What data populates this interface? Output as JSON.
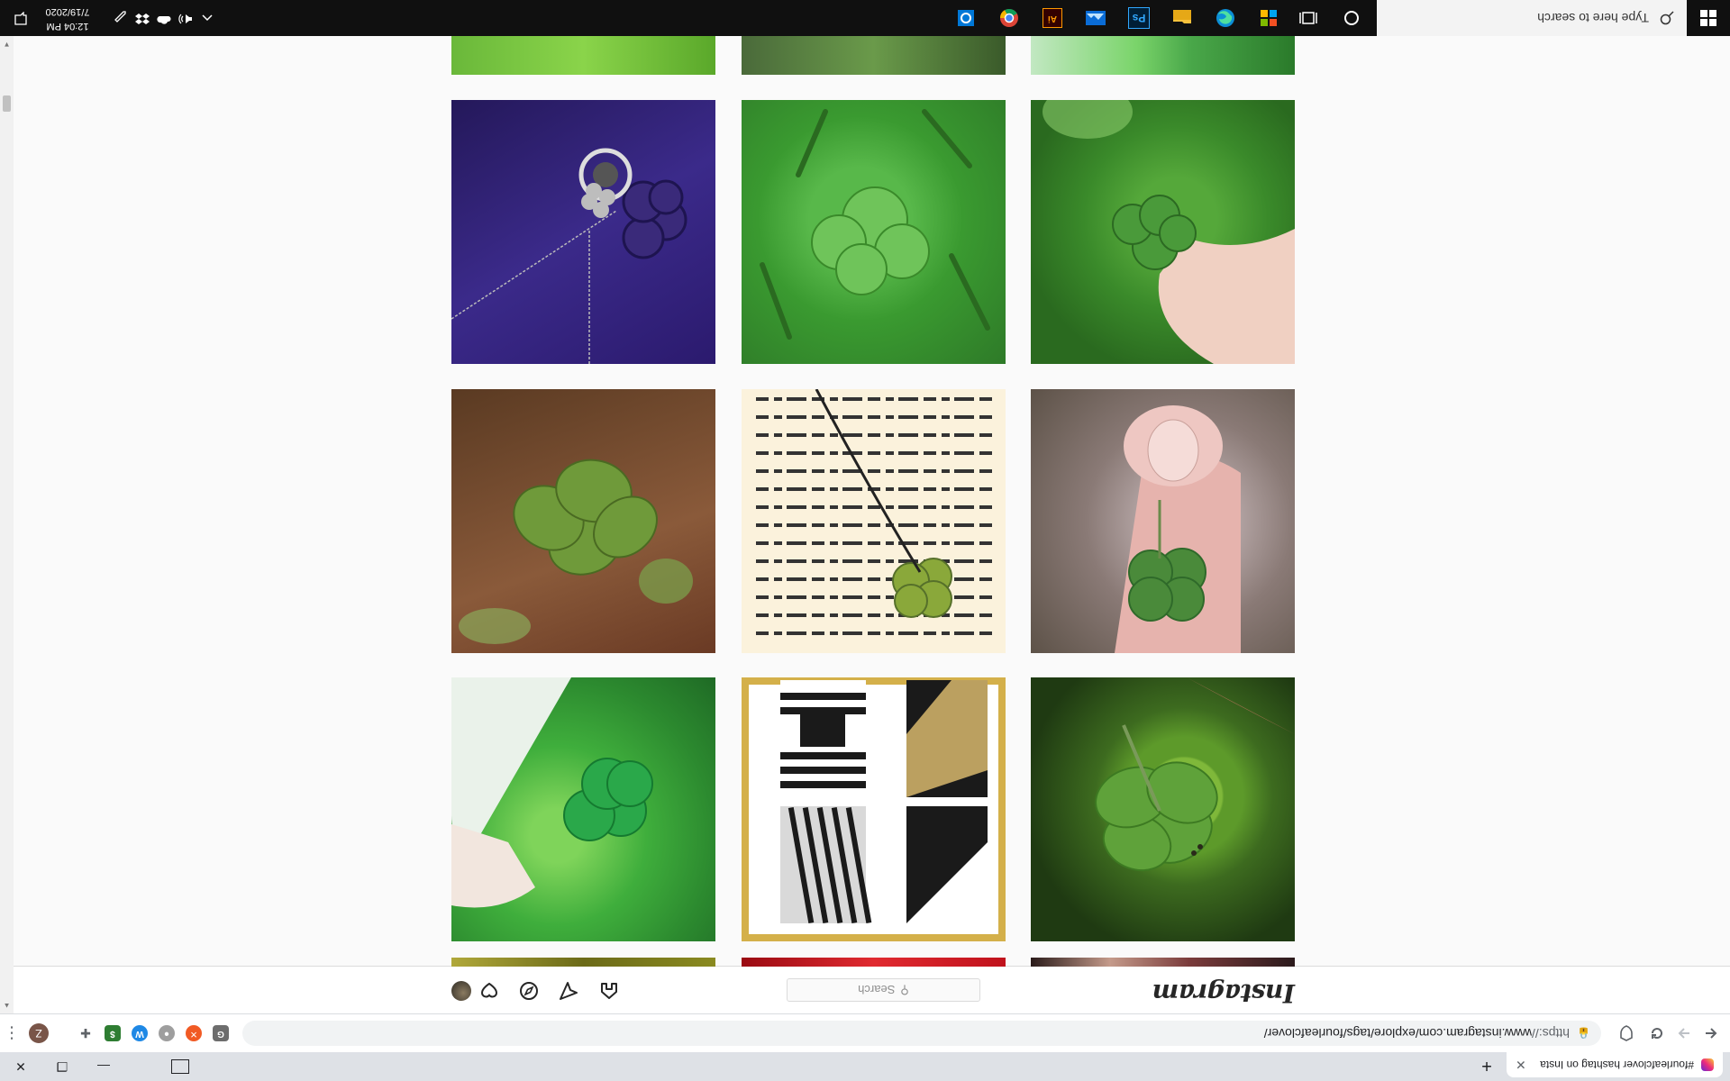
{
  "browser": {
    "tab_title": "#fourleafclover hashtag on Insta",
    "tab_close": "✕",
    "new_tab": "+",
    "window_controls": {
      "minimize": "—",
      "restore": "❐",
      "close": "✕"
    },
    "url_scheme": "https://",
    "url_rest": "www.instagram.com/explore/tags/fourleafclover/",
    "profile_initial": "Z",
    "menu": "⋮"
  },
  "instagram": {
    "logo": "Instagram",
    "search_placeholder": "Search",
    "search_icon_glyph": "⚲"
  },
  "taskbar": {
    "search_placeholder": "Type here to search",
    "time": "12:04 PM",
    "date": "7/19/2020",
    "ai_label": "Ai",
    "ps_label": "Ps"
  }
}
